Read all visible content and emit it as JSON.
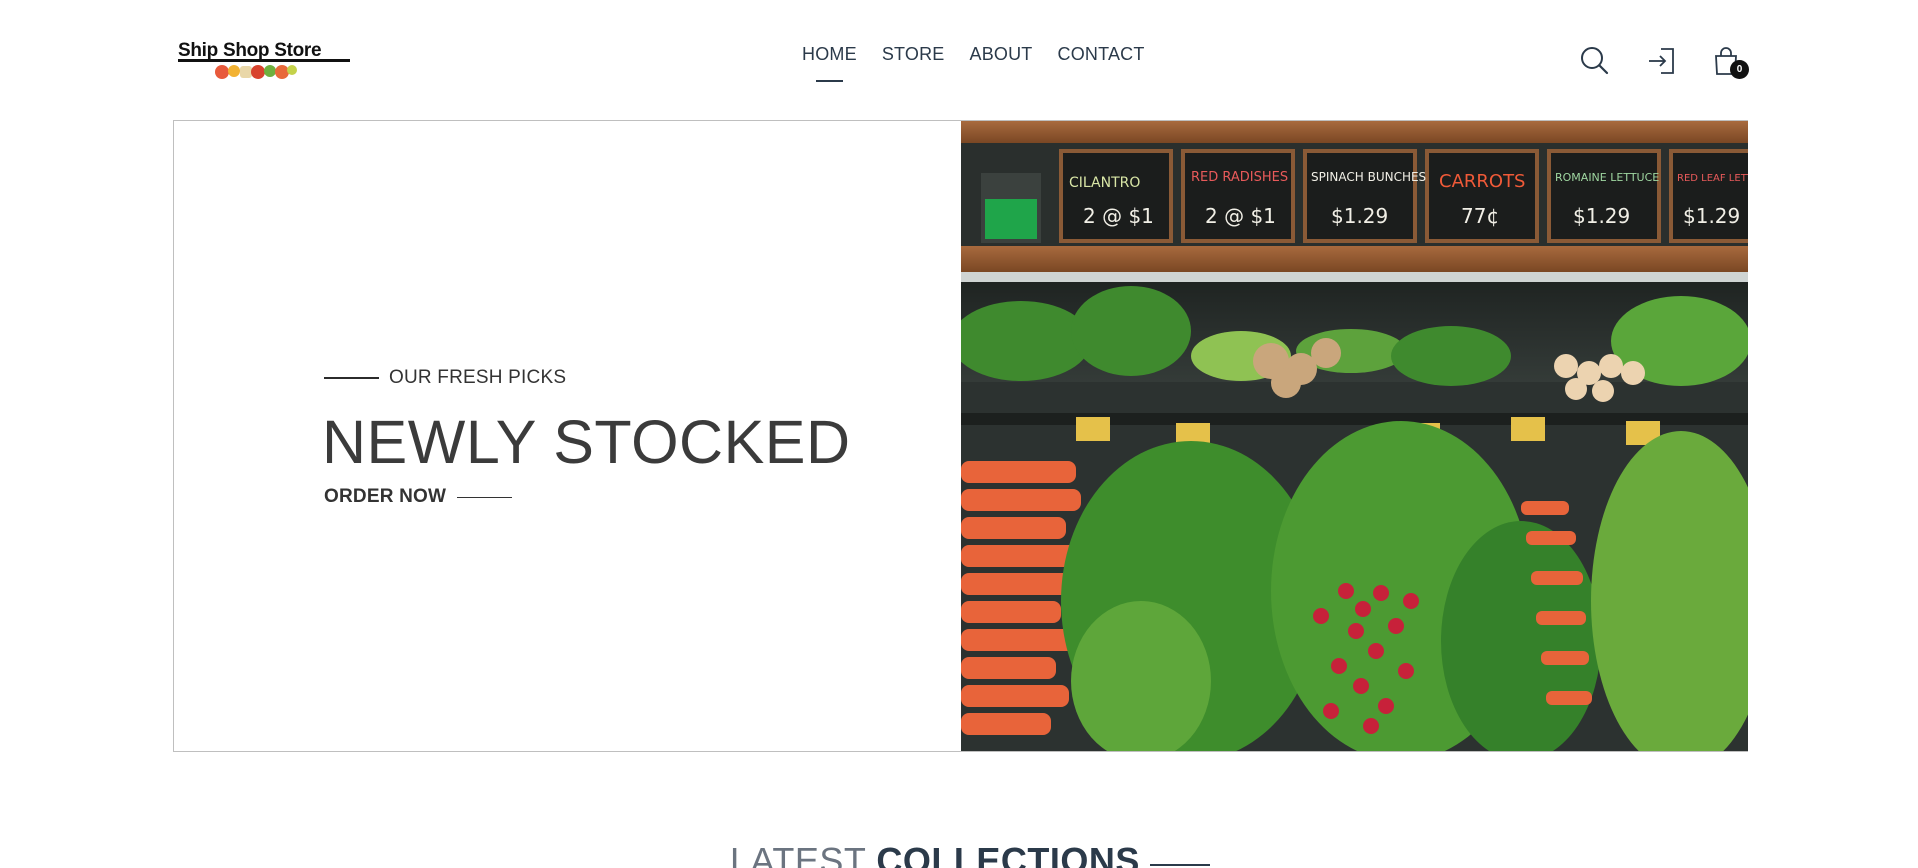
{
  "brand": {
    "name": "Ship Shop Store"
  },
  "nav": {
    "items": [
      {
        "label": "HOME",
        "active": true
      },
      {
        "label": "STORE",
        "active": false
      },
      {
        "label": "ABOUT",
        "active": false
      },
      {
        "label": "CONTACT",
        "active": false
      }
    ]
  },
  "header_icons": {
    "search": "search-icon",
    "login": "login-icon",
    "cart": "shopping-bag-icon",
    "cart_count": "0"
  },
  "hero": {
    "eyebrow": "OUR FRESH PICKS",
    "title": "NEWLY STOCKED",
    "cta": "ORDER NOW",
    "image_signs": [
      {
        "name": "CILANTRO",
        "price": "2 @ $1"
      },
      {
        "name": "RED RADISHES",
        "price": "2 @ $1"
      },
      {
        "name": "SPINACH BUNCHES",
        "price": "$1.29"
      },
      {
        "name": "CARROTS",
        "price": "77¢"
      },
      {
        "name": "ROMAINE LETTUCE",
        "price": "$1.29"
      },
      {
        "name": "RED LEAF LETTUCE",
        "price": "$1.29"
      }
    ]
  },
  "section": {
    "light": "LATEST",
    "bold": "COLLECTIONS"
  },
  "colors": {
    "text": "#2b3a4a",
    "accent": "#111111",
    "border": "#bfbfbf"
  }
}
